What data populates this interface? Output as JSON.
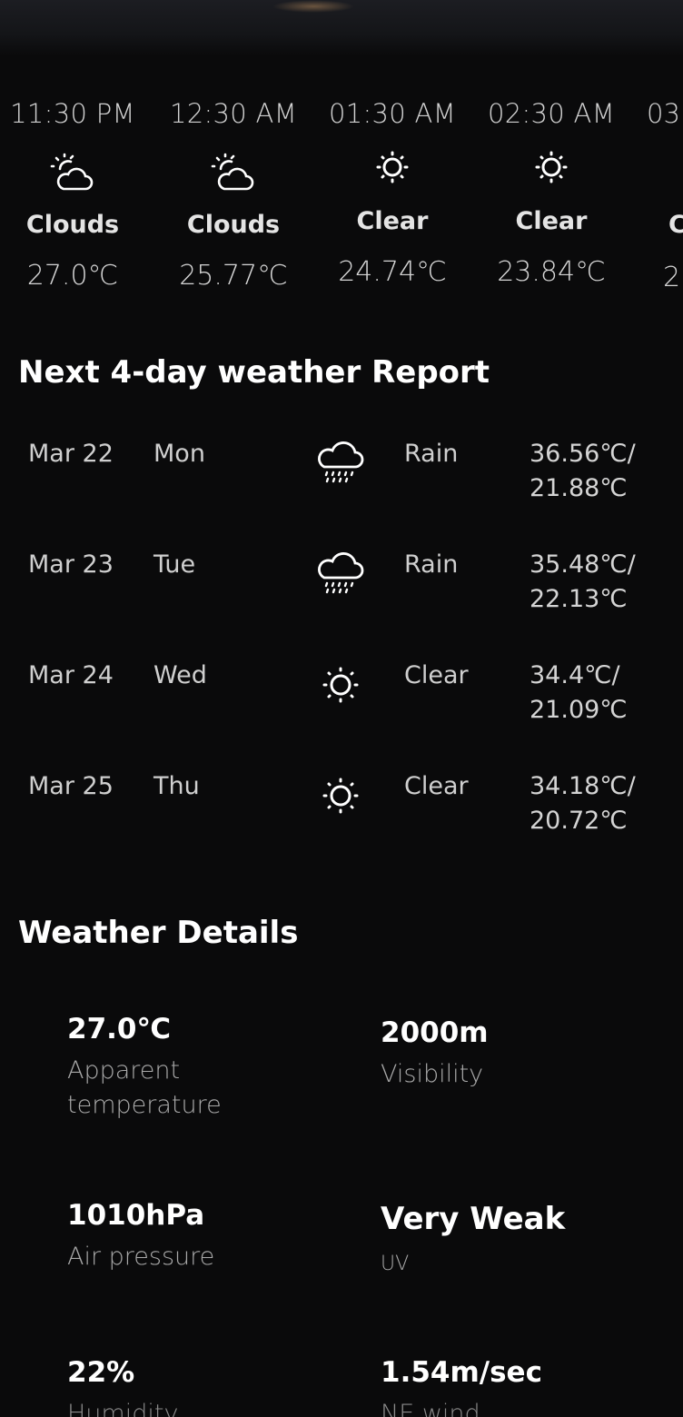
{
  "hourly": [
    {
      "time": "11:30 PM",
      "icon": "partly-cloudy-night-icon",
      "condition": "Clouds",
      "temp": "27.0℃"
    },
    {
      "time": "12:30 AM",
      "icon": "partly-cloudy-night-icon",
      "condition": "Clouds",
      "temp": "25.77℃"
    },
    {
      "time": "01:30 AM",
      "icon": "sun-icon",
      "condition": "Clear",
      "temp": "24.74℃"
    },
    {
      "time": "02:30 AM",
      "icon": "sun-icon",
      "condition": "Clear",
      "temp": "23.84℃"
    },
    {
      "time": "03",
      "condition": "C",
      "temp": "2"
    }
  ],
  "forecast": {
    "title": "Next 4-day weather Report",
    "days": [
      {
        "date": "Mar 22",
        "weekday": "Mon",
        "icon": "rain-cloud-icon",
        "condition": "Rain",
        "high": "36.56℃/",
        "low": "21.88℃"
      },
      {
        "date": "Mar 23",
        "weekday": "Tue",
        "icon": "rain-cloud-icon",
        "condition": "Rain",
        "high": "35.48℃/",
        "low": "22.13℃"
      },
      {
        "date": "Mar 24",
        "weekday": "Wed",
        "icon": "sun-icon",
        "condition": "Clear",
        "high": "34.4℃/",
        "low": "21.09℃"
      },
      {
        "date": "Mar 25",
        "weekday": "Thu",
        "icon": "sun-icon",
        "condition": "Clear",
        "high": "34.18℃/",
        "low": "20.72℃"
      }
    ]
  },
  "details": {
    "title": "Weather Details",
    "apparent_temp": {
      "value": "27.0℃",
      "label_line1": "Apparent",
      "label_line2": "temperature"
    },
    "visibility": {
      "value": "2000m",
      "label": "Visibility"
    },
    "air_pressure": {
      "value": "1010hPa",
      "label": "Air pressure"
    },
    "uv": {
      "value": "Very Weak",
      "label": "UV"
    },
    "humidity": {
      "value": "22%",
      "label": "Humidity"
    },
    "wind": {
      "value": "1.54m/sec",
      "label": "NE wind"
    }
  }
}
